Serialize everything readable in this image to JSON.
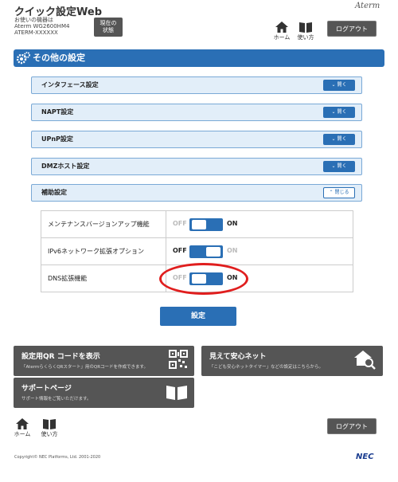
{
  "header": {
    "title": "クイック設定Web",
    "device_line1": "お使いの機器は",
    "device_line2": "Aterm WG2600HM4",
    "device_line3": "ATERM-XXXXXX",
    "status_button_line1": "現在の",
    "status_button_line2": "状態",
    "brand": "Aterm",
    "home_label": "ホーム",
    "help_label": "使い方",
    "logout_label": "ログアウト"
  },
  "section": {
    "title": "その他の設定"
  },
  "accordion": [
    {
      "label": "インタフェース設定",
      "button": "開く"
    },
    {
      "label": "NAPT設定",
      "button": "開く"
    },
    {
      "label": "UPnP設定",
      "button": "開く"
    },
    {
      "label": "DMZホスト設定",
      "button": "開く"
    },
    {
      "label": "補助設定",
      "button": "閉じる"
    }
  ],
  "settings": [
    {
      "label": "メンテナンスバージョンアップ機能",
      "off": "OFF",
      "on": "ON",
      "state": "on"
    },
    {
      "label": "IPv6ネットワーク拡張オプション",
      "off": "OFF",
      "on": "ON",
      "state": "off"
    },
    {
      "label": "DNS拡張機能",
      "off": "OFF",
      "on": "ON",
      "state": "on"
    }
  ],
  "apply_label": "設定",
  "tiles": [
    {
      "title": "設定用QR コードを表示",
      "sub": "「AtermらくらくQRスタート」用のQRコードを作成できます。",
      "icon": "qr-code-icon"
    },
    {
      "title": "見えて安心ネット",
      "sub": "「こども安心ネットタイマー」などの設定はこちらから。",
      "icon": "house-search-icon"
    },
    {
      "title": "サポートページ",
      "sub": "サポート情報をご覧いただけます。",
      "icon": "book-icon"
    }
  ],
  "footer": {
    "home_label": "ホーム",
    "help_label": "使い方",
    "logout_label": "ログアウト",
    "copyright": "Copyright© NEC Platforms, Ltd. 2001-2020",
    "logo": "NEC"
  },
  "colors": {
    "accent": "#2a6fb5",
    "dark_button": "#555555",
    "accordion_bg": "#e2eef9",
    "highlight": "#e01e1e"
  }
}
